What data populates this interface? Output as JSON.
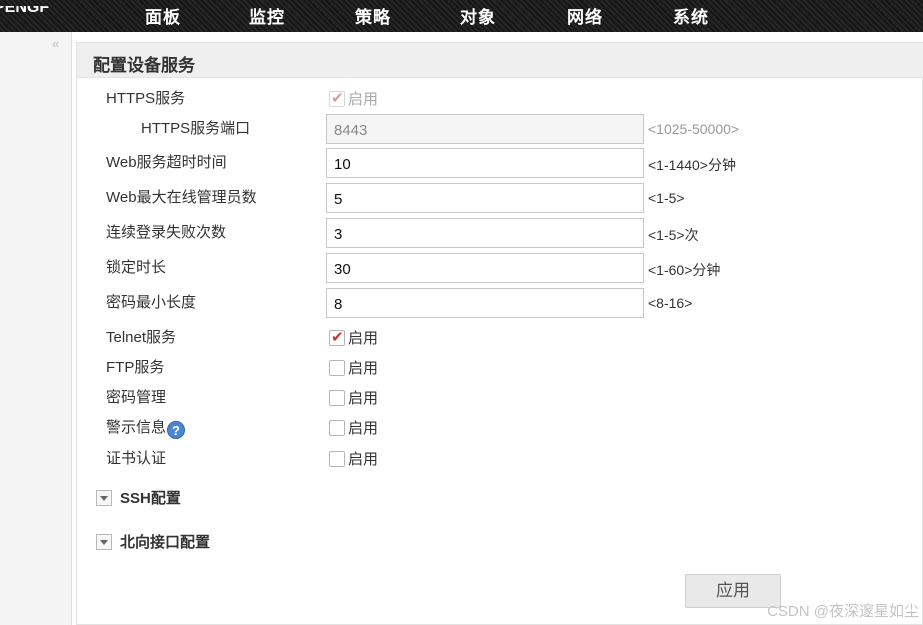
{
  "topbar": {
    "logo_partial": "PENGF",
    "nav": [
      "面板",
      "监控",
      "策略",
      "对象",
      "网络",
      "系统"
    ]
  },
  "sidebar": {
    "collapse_icon": "double-chevron-left-icon",
    "collapse_glyph": "«"
  },
  "panel": {
    "title": "配置设备服务",
    "https": {
      "label": "HTTPS服务",
      "checked": true,
      "disabled": true,
      "option": "启用"
    },
    "https_port": {
      "label": "HTTPS服务端口",
      "value": "8443",
      "hint": "<1025-50000>"
    },
    "web_timeout": {
      "label": "Web服务超时时间",
      "value": "10",
      "hint": "<1-1440>分钟"
    },
    "web_max_admins": {
      "label": "Web最大在线管理员数",
      "value": "5",
      "hint": "<1-5>"
    },
    "login_failures": {
      "label": "连续登录失败次数",
      "value": "3",
      "hint": "<1-5>次"
    },
    "lock_duration": {
      "label": "锁定时长",
      "value": "30",
      "hint": "<1-60>分钟"
    },
    "password_min_length": {
      "label": "密码最小长度",
      "value": "8",
      "hint": "<8-16>"
    },
    "telnet": {
      "label": "Telnet服务",
      "checked": true,
      "option": "启用"
    },
    "ftp": {
      "label": "FTP服务",
      "checked": false,
      "option": "启用"
    },
    "password_mgmt": {
      "label": "密码管理",
      "checked": false,
      "option": "启用"
    },
    "warning_info": {
      "label": "警示信息",
      "checked": false,
      "option": "启用",
      "help_icon": "question-icon",
      "help_glyph": "?"
    },
    "certificate_auth": {
      "label": "证书认证",
      "checked": false,
      "option": "启用"
    },
    "sections": [
      {
        "label": "SSH配置",
        "icon": "collapse-triangle-icon"
      },
      {
        "label": "北向接口配置",
        "icon": "collapse-triangle-icon"
      }
    ],
    "apply_label": "应用"
  },
  "watermark": "CSDN @夜深邃星如尘",
  "colors": {
    "topbar": "#1e1e1e",
    "check": "#c0392b",
    "help_icon": "#4a86d1"
  }
}
